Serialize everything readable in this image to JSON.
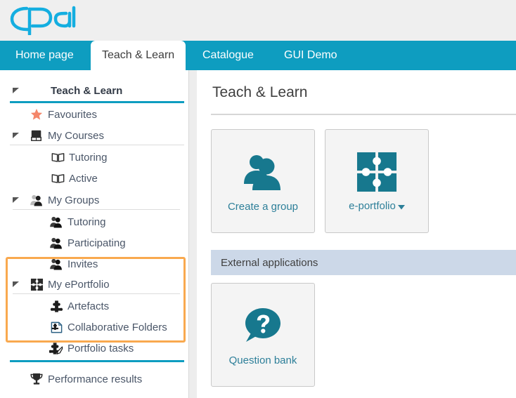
{
  "app": {
    "logo_text": "Opal",
    "brand_color": "#0e9dc0",
    "accent_color": "#f9a94f",
    "tile_icon_color": "#17788e",
    "link_color": "#2d7f99"
  },
  "nav": {
    "tabs": [
      {
        "label": "Home page",
        "active": false
      },
      {
        "label": "Teach & Learn",
        "active": true
      },
      {
        "label": "Catalogue",
        "active": false
      },
      {
        "label": "GUI Demo",
        "active": false
      }
    ]
  },
  "sidebar": {
    "items": [
      {
        "label": "Teach & Learn",
        "icon": "caret-down-icon",
        "level": 0,
        "expandable": true
      },
      {
        "label": "Favourites",
        "icon": "star-icon",
        "level": 1,
        "expandable": false
      },
      {
        "label": "My Courses",
        "icon": "book-closed-icon",
        "level": 0,
        "expandable": true
      },
      {
        "label": "Tutoring",
        "icon": "book-open-icon",
        "level": 2,
        "expandable": false
      },
      {
        "label": "Active",
        "icon": "book-open-icon",
        "level": 2,
        "expandable": false
      },
      {
        "label": "My Groups",
        "icon": "group-icon",
        "level": 0,
        "expandable": true
      },
      {
        "label": "Tutoring",
        "icon": "group-icon",
        "level": 2,
        "expandable": false
      },
      {
        "label": "Participating",
        "icon": "group-icon",
        "level": 2,
        "expandable": false
      },
      {
        "label": "Invites",
        "icon": "group-icon",
        "level": 2,
        "expandable": false
      },
      {
        "label": "My ePortfolio",
        "icon": "puzzle-icon",
        "level": 0,
        "expandable": true
      },
      {
        "label": "Artefacts",
        "icon": "puzzle-piece-icon",
        "level": 2,
        "expandable": false
      },
      {
        "label": "Collaborative Folders",
        "icon": "folder-puzzle-icon",
        "level": 2,
        "expandable": false
      },
      {
        "label": "Portfolio tasks",
        "icon": "puzzle-pencil-icon",
        "level": 2,
        "expandable": false
      },
      {
        "label": "Performance results",
        "icon": "trophy-icon",
        "level": 1,
        "expandable": false
      }
    ],
    "highlighted_group": "My Groups"
  },
  "main": {
    "title": "Teach & Learn",
    "tiles": [
      {
        "label": "Create a group",
        "icon": "two-people-icon",
        "has_dropdown": false
      },
      {
        "label": "e-portfolio",
        "icon": "puzzle-icon",
        "has_dropdown": true,
        "caret": "▼"
      }
    ],
    "section": {
      "heading": "External applications",
      "tiles": [
        {
          "label": "Question bank",
          "icon": "question-bubble-icon",
          "has_dropdown": false
        }
      ]
    }
  }
}
